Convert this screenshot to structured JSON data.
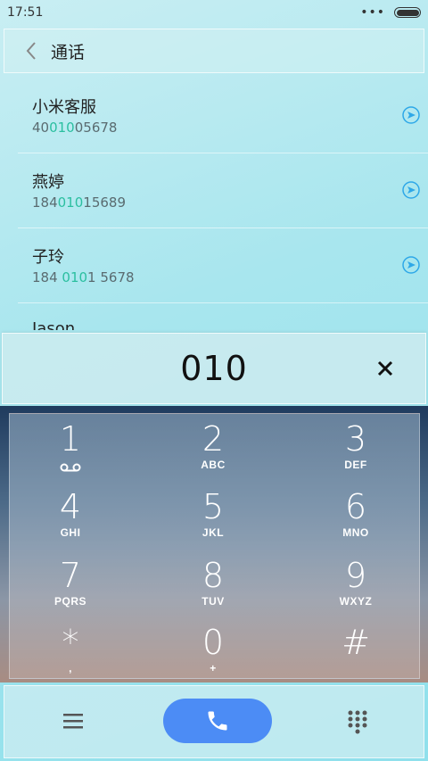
{
  "status": {
    "time": "17:51",
    "dots": "•••"
  },
  "header": {
    "title": "通话"
  },
  "contacts": [
    {
      "name": "小米客服",
      "num_pre": "40",
      "num_hl": "010",
      "num_post": "05678"
    },
    {
      "name": "燕婷",
      "num_pre": "184",
      "num_hl": "010",
      "num_post": "15689"
    },
    {
      "name": "子玲",
      "num_pre": "184 ",
      "num_hl": "010",
      "num_post": "1 5678"
    },
    {
      "name": "Jason",
      "num_pre": "",
      "num_hl": "",
      "num_post": ""
    }
  ],
  "dialer": {
    "number": "010"
  },
  "keypad": [
    {
      "digit": "1",
      "letters": ""
    },
    {
      "digit": "2",
      "letters": "ABC"
    },
    {
      "digit": "3",
      "letters": "DEF"
    },
    {
      "digit": "4",
      "letters": "GHI"
    },
    {
      "digit": "5",
      "letters": "JKL"
    },
    {
      "digit": "6",
      "letters": "MNO"
    },
    {
      "digit": "7",
      "letters": "PQRS"
    },
    {
      "digit": "8",
      "letters": "TUV"
    },
    {
      "digit": "9",
      "letters": "WXYZ"
    },
    {
      "digit": "*",
      "letters": ","
    },
    {
      "digit": "0",
      "letters": "+"
    },
    {
      "digit": "#",
      "letters": ""
    }
  ],
  "colors": {
    "accent": "#4c8cf5",
    "highlight": "#2bbfa0",
    "link": "#2ea8e8"
  },
  "icons": {
    "back": "chevron-left-icon",
    "go": "arrow-circle-right-icon",
    "clear": "close-icon",
    "menu": "menu-icon",
    "call": "phone-icon",
    "dialpad": "dialpad-icon",
    "voicemail": "voicemail-icon"
  }
}
